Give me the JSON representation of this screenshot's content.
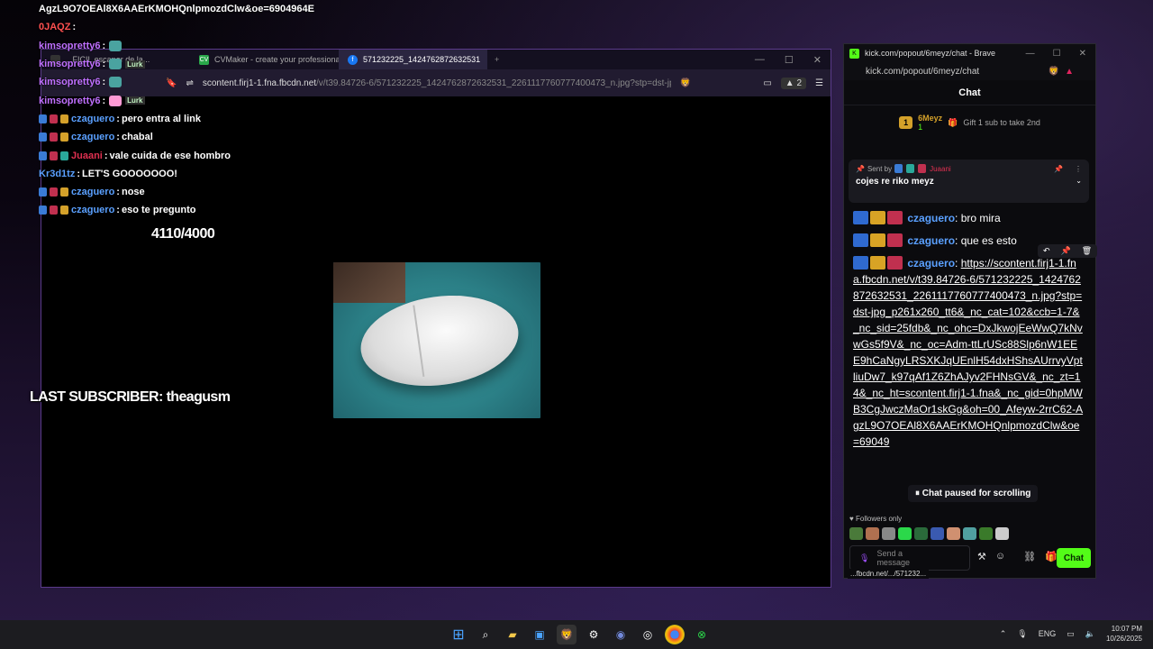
{
  "overlay_chat": {
    "top_line": "AgzL9O7OEAl8X6AAErKMOHQnlpmozdClw&oe=6904964E",
    "rows": [
      {
        "user": "0JAQZ",
        "text": "",
        "color": "#ff5050",
        "badges": []
      },
      {
        "user": "kimsopretty6",
        "text": "",
        "color": "#c070ff",
        "badges": []
      },
      {
        "user": "kimsopretty6",
        "text": "",
        "color": "#c070ff",
        "badges": []
      },
      {
        "user": "kimsopretty6",
        "text": "",
        "color": "#c070ff",
        "badges": []
      },
      {
        "user": "kimsopretty6",
        "text": "",
        "color": "#c070ff",
        "badges": []
      },
      {
        "user": "czaguero",
        "text": "pero entra al link",
        "color": "#5aa0ff",
        "badges": [
          "blue",
          "red",
          "gold"
        ]
      },
      {
        "user": "czaguero",
        "text": "chabal",
        "color": "#5aa0ff",
        "badges": [
          "blue",
          "red",
          "gold"
        ]
      },
      {
        "user": "Juaani",
        "text": "vale cuida de ese hombro",
        "color": "#e03050",
        "badges": [
          "blue",
          "red",
          "teal"
        ]
      },
      {
        "user": "Kr3d1tz",
        "text": "LET'S GOOOOOOO!",
        "color": "#5aa0ff",
        "badges": []
      },
      {
        "user": "czaguero",
        "text": "nose",
        "color": "#5aa0ff",
        "badges": [
          "blue",
          "red",
          "gold"
        ]
      },
      {
        "user": "czaguero",
        "text": "eso te pregunto",
        "color": "#5aa0ff",
        "badges": [
          "blue",
          "red",
          "gold"
        ]
      }
    ],
    "emote_tags": [
      "",
      "Lurk",
      "",
      "Lurk"
    ]
  },
  "counter": "4110/4000",
  "last_subscriber": "LAST SUBSCRIBER: theagusm",
  "browser1": {
    "tabs": [
      {
        "label": "...FICIL escapar de la...",
        "fav_color": "#333"
      },
      {
        "label": "CVMaker - create your professional...",
        "fav_color": "#2aa84a",
        "fav_text": "CV"
      },
      {
        "label": "571232225_1424762872632531",
        "fav_color": "#1877f2",
        "fav_text": "f"
      }
    ],
    "url_host": "scontent.firj1-1.fna.fbcdn.net",
    "url_path": "/v/t39.84726-6/571232225_1424762872632531_2261117760777400473_n.jpg?stp=dst-jpg_p...",
    "count": "2"
  },
  "kick": {
    "window_title": "kick.com/popout/6meyz/chat - Brave",
    "address": "kick.com/popout/6meyz/chat",
    "chat_title": "Chat",
    "gifter_rank": "1",
    "gifter_name": "6Meyz",
    "gifter_count": "1",
    "gift_text": "Gift 1 sub to take 2nd",
    "pinned_sent_by": "Sent by",
    "pinned_user": "Juaani",
    "pinned_text": "cojes re riko meyz",
    "messages": [
      {
        "user": "czaguero",
        "text": "bro mira"
      },
      {
        "user": "czaguero",
        "text": "que es esto"
      }
    ],
    "link_user": "czaguero",
    "link_text": "https://scontent.firj1-1.fna.fbcdn.net/v/t39.84726-6/571232225_1424762872632531_2261117760777400473_n.jpg?stp=dst-jpg_p261x260_tt6&_nc_cat=102&ccb=1-7&_nc_sid=25fdb&_nc_ohc=DxJkwojEeWwQ7kNvwGs5f9V&_nc_oc=Adm-ttLrUSc88Slp6nW1EEE9hCaNgyLRSXKJqUEnlH54dxHShsAUrrvyVptliuDw7_k97qAf1Z6ZhAJyv2FHNsGV&_nc_zt=14&_nc_ht=scontent.firj1-1.fna&_nc_gid=0hpMWB3CgJwczMaOr1skGg&oh=00_Afeyw-2rrC62-AgzL9O7OEAl8X6AAErKMOHQnlpmozdClw&oe=69049",
    "paused": "Chat paused for scrolling",
    "followers_only": "Followers only",
    "input_placeholder": "Send a message",
    "chat_button": "Chat",
    "status_url": "...fbcdn.net/.../571232..."
  },
  "tray": {
    "lang": "ENG",
    "time": "10:07 PM",
    "date": "10/26/2025"
  }
}
